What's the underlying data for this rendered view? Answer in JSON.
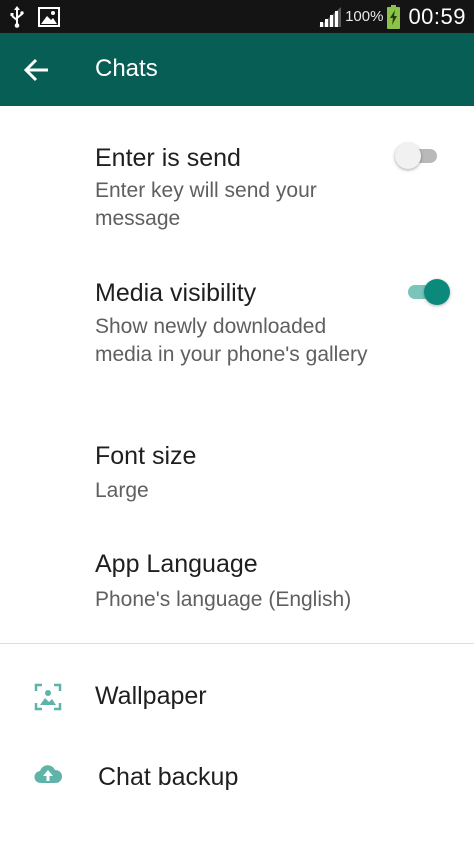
{
  "status_bar": {
    "battery_percent": "100%",
    "time": "00:59",
    "icons": [
      "usb-icon",
      "image-icon",
      "signal-icon",
      "battery-charging-icon"
    ]
  },
  "toolbar": {
    "title": "Chats",
    "back_icon": "arrow-left-icon",
    "background_color": "#075e54"
  },
  "settings": [
    {
      "title": "Enter is send",
      "subtitle": "Enter key will send your message",
      "toggle": "off"
    },
    {
      "title": "Media visibility",
      "subtitle": "Show newly downloaded media in your phone's gallery",
      "toggle": "on"
    },
    {
      "title": "Font size",
      "subtitle": "Large"
    },
    {
      "title": "App Language",
      "subtitle": "Phone's language (English)"
    }
  ],
  "actions": [
    {
      "label": "Wallpaper",
      "icon": "wallpaper-icon"
    },
    {
      "label": "Chat backup",
      "icon": "cloud-upload-icon"
    }
  ],
  "colors": {
    "accent": "#0b8a7c",
    "icon_teal": "#5fb3a9",
    "toolbar": "#075e54"
  }
}
